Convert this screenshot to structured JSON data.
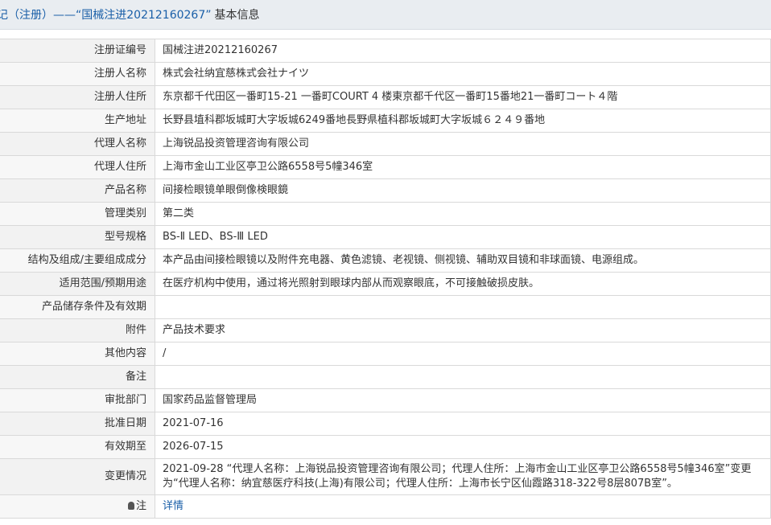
{
  "header": {
    "breadcrumb": "记（注册）——“国械注进20212160267”",
    "suffix": "基本信息"
  },
  "rows": [
    {
      "label": "注册证编号",
      "value": "国械注进20212160267"
    },
    {
      "label": "注册人名称",
      "value": "株式会社纳宜慈株式会社ナイツ"
    },
    {
      "label": "注册人住所",
      "value": "东京都千代田区一番町15-21 一番町COURT 4 楼東京都千代区一番町15番地21一番町コート４階"
    },
    {
      "label": "生产地址",
      "value": "长野县埴科郡坂城町大字坂城6249番地長野県植科郡坂城町大字坂城６２４９番地"
    },
    {
      "label": "代理人名称",
      "value": "上海锐品投资管理咨询有限公司"
    },
    {
      "label": "代理人住所",
      "value": "上海市金山工业区亭卫公路6558号5幢346室"
    },
    {
      "label": "产品名称",
      "value": "间接检眼镜单眼倒像検眼鏡"
    },
    {
      "label": "管理类别",
      "value": "第二类"
    },
    {
      "label": "型号规格",
      "value": "BS-Ⅱ LED、BS-Ⅲ LED"
    },
    {
      "label": "结构及组成/主要组成成分",
      "value": "本产品由间接检眼镜以及附件充电器、黄色滤镜、老视镜、侧视镜、辅助双目镜和非球面镜、电源组成。"
    },
    {
      "label": "适用范围/预期用途",
      "value": "在医疗机构中使用，通过将光照射到眼球内部从而观察眼底，不可接触破损皮肤。"
    },
    {
      "label": "产品储存条件及有效期",
      "value": ""
    },
    {
      "label": "附件",
      "value": "产品技术要求"
    },
    {
      "label": "其他内容",
      "value": "/"
    },
    {
      "label": "备注",
      "value": ""
    },
    {
      "label": "审批部门",
      "value": "国家药品监督管理局"
    },
    {
      "label": "批准日期",
      "value": "2021-07-16"
    },
    {
      "label": "有效期至",
      "value": "2026-07-15"
    },
    {
      "label": "变更情况",
      "value": "2021-09-28 “代理人名称：上海锐品投资管理咨询有限公司；代理人住所：上海市金山工业区亭卫公路6558号5幢346室”变更为“代理人名称：纳宜慈医疗科技(上海)有限公司；代理人住所：上海市长宁区仙霞路318-322号8层807B室”。"
    }
  ],
  "note": {
    "label": "注",
    "link": "详情"
  }
}
